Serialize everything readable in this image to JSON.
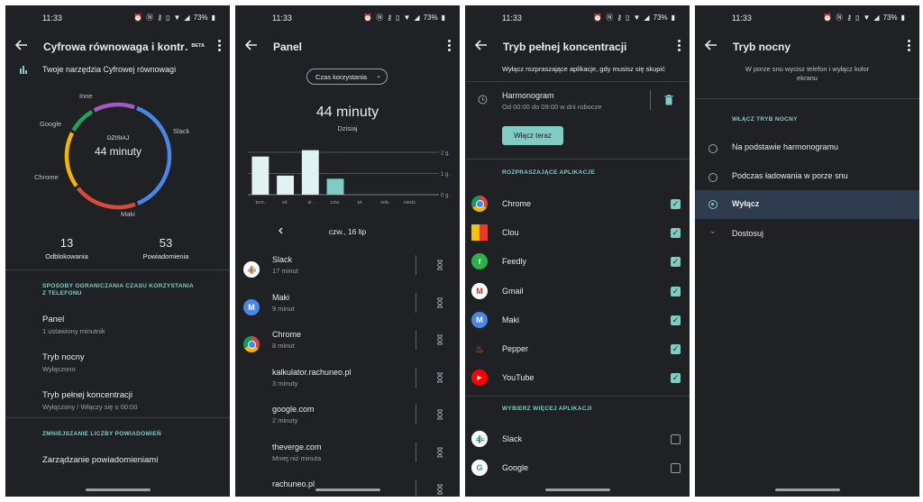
{
  "status": {
    "time": "11:33",
    "battery": "73%"
  },
  "screen1": {
    "title": "Cyfrowa równowaga i kontr…",
    "badge": "BETA",
    "header_text": "Twoje narzędzia Cyfrowej równowagi",
    "donut": {
      "center_label": "DZISIAJ",
      "center_value": "44 minuty",
      "segments": [
        {
          "label": "Slack",
          "value": 17,
          "color": "#4a86e8"
        },
        {
          "label": "Maki",
          "value": 9,
          "color": "#d94a3d"
        },
        {
          "label": "Chrome",
          "value": 8,
          "color": "#f6b400"
        },
        {
          "label": "Google",
          "value": 4,
          "color": "#20a35a"
        },
        {
          "label": "Inne",
          "value": 6,
          "color": "#a259c8"
        }
      ]
    },
    "unlocks_value": "13",
    "unlocks_label": "Odblokowania",
    "notifications_value": "53",
    "notifications_label": "Powiadomienia",
    "section1_line1": "SPOSOBY OGRANICZANIA CZASU KORZYSTANIA",
    "section1_line2": "Z TELEFONU",
    "items": [
      {
        "title": "Panel",
        "sub": "1 ustawiony minutnik"
      },
      {
        "title": "Tryb nocny",
        "sub": "Wyłączono"
      },
      {
        "title": "Tryb pełnej koncentracji",
        "sub": "Wyłączony / Włączy się o 00:00"
      }
    ],
    "section2": "ZMNIEJSZANIE LICZBY POWIADOMIEŃ",
    "notif_item": "Zarządzanie powiadomieniami"
  },
  "screen2": {
    "title": "Panel",
    "dropdown": "Czas korzystania",
    "total": "44 minuty",
    "total_label": "Dzisiaj",
    "chart_data": {
      "type": "bar",
      "categories": [
        "pon.",
        "wt.",
        "śr.",
        "czw.",
        "pt.",
        "sob.",
        "niedz."
      ],
      "values": [
        1.8,
        0.9,
        2.1,
        0.75,
        0,
        0,
        0
      ],
      "ylim": [
        0,
        2
      ],
      "ytick_labels": [
        "0 g.",
        "1 g.",
        "2 g."
      ],
      "highlight_index": 3
    },
    "date": "czw., 16 lip",
    "apps": [
      {
        "name": "Slack",
        "time": "17 minut",
        "icon": "slack-icon"
      },
      {
        "name": "Maki",
        "time": "9 minut",
        "icon": "maki-icon"
      },
      {
        "name": "Chrome",
        "time": "8 minut",
        "icon": "chrome-icon"
      },
      {
        "name": "kalkulator.rachuneo.pl",
        "time": "3 minuty",
        "icon": ""
      },
      {
        "name": "google.com",
        "time": "2 minuty",
        "icon": ""
      },
      {
        "name": "theverge.com",
        "time": "Mniej niż minuta",
        "icon": ""
      },
      {
        "name": "rachuneo.pl",
        "time": "",
        "icon": ""
      }
    ]
  },
  "screen3": {
    "title": "Tryb pełnej koncentracji",
    "description": "Wyłącz rozpraszające aplikacje, gdy musisz się skupić",
    "schedule_title": "Harmonogram",
    "schedule_sub": "Od 00:00 do 09:00 w dni robocze",
    "button": "Włącz teraz",
    "section1": "ROZPRASZAJĄCE APLIKACJE",
    "apps": [
      {
        "name": "Chrome",
        "checked": true
      },
      {
        "name": "Clou",
        "checked": true
      },
      {
        "name": "Feedly",
        "checked": true
      },
      {
        "name": "Gmail",
        "checked": true
      },
      {
        "name": "Maki",
        "checked": true
      },
      {
        "name": "Pepper",
        "checked": true
      },
      {
        "name": "YouTube",
        "checked": true
      }
    ],
    "section2": "WYBIERZ WIĘCEJ APLIKACJI",
    "more_apps": [
      {
        "name": "Slack",
        "checked": false
      },
      {
        "name": "Google",
        "checked": false
      }
    ]
  },
  "screen4": {
    "title": "Tryb nocny",
    "description_line1": "W porze snu wycisz telefon i wyłącz kolor",
    "description_line2": "ekranu",
    "section": "WŁĄCZ TRYB NOCNY",
    "options": [
      {
        "label": "Na podstawie harmonogramu",
        "selected": false
      },
      {
        "label": "Podczas ładowania w porze snu",
        "selected": false
      },
      {
        "label": "Wyłącz",
        "selected": true
      }
    ],
    "customize": "Dostosuj"
  },
  "colors": {
    "background": "#202124",
    "accent": "#80cbc4",
    "selected_row": "#2f3c4f"
  }
}
